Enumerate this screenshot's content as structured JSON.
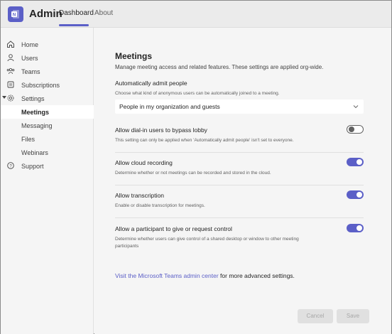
{
  "header": {
    "app_title": "Admin",
    "tabs": [
      {
        "label": "Dashboard",
        "active": true
      },
      {
        "label": "About",
        "active": false
      }
    ],
    "accent": "#5b5fc7"
  },
  "sidebar": {
    "items": [
      {
        "label": "Home",
        "icon": "home-icon"
      },
      {
        "label": "Users",
        "icon": "user-icon"
      },
      {
        "label": "Teams",
        "icon": "teams-icon"
      },
      {
        "label": "Subscriptions",
        "icon": "list-icon"
      },
      {
        "label": "Settings",
        "icon": "gear-icon",
        "expanded": true
      },
      {
        "label": "Meetings",
        "active": true
      },
      {
        "label": "Messaging"
      },
      {
        "label": "Files"
      },
      {
        "label": "Webinars"
      },
      {
        "label": "Support",
        "icon": "help-icon"
      }
    ]
  },
  "main": {
    "title": "Meetings",
    "description": "Manage meeting access and related features. These settings are applied org-wide.",
    "auto_admit": {
      "title": "Automatically admit people",
      "description": "Choose what kind of anonymous users can be automatically joined to a meeting.",
      "selected": "People in my organization and guests"
    },
    "settings": [
      {
        "title": "Allow dial-in users to bypass lobby",
        "description": "This setting can only be applied when 'Automatically admit people' isn't set to everyone.",
        "enabled": false
      },
      {
        "title": "Allow cloud recording",
        "description": "Determine whether or not meetings can be recorded and stored in the cloud.",
        "enabled": true
      },
      {
        "title": "Allow transcription",
        "description": "Enable or disable transcription for meetings.",
        "enabled": true
      },
      {
        "title": "Allow a participant to give or request control",
        "description_line1": "Determine whether users can give control of a shared desktop or window to other meeting",
        "description_line2": "participants",
        "enabled": true
      }
    ],
    "footer": {
      "link_text": "Visit the Microsoft Teams admin center",
      "suffix": " for more advanced settings."
    },
    "buttons": {
      "cancel": "Cancel",
      "save": "Save"
    }
  }
}
